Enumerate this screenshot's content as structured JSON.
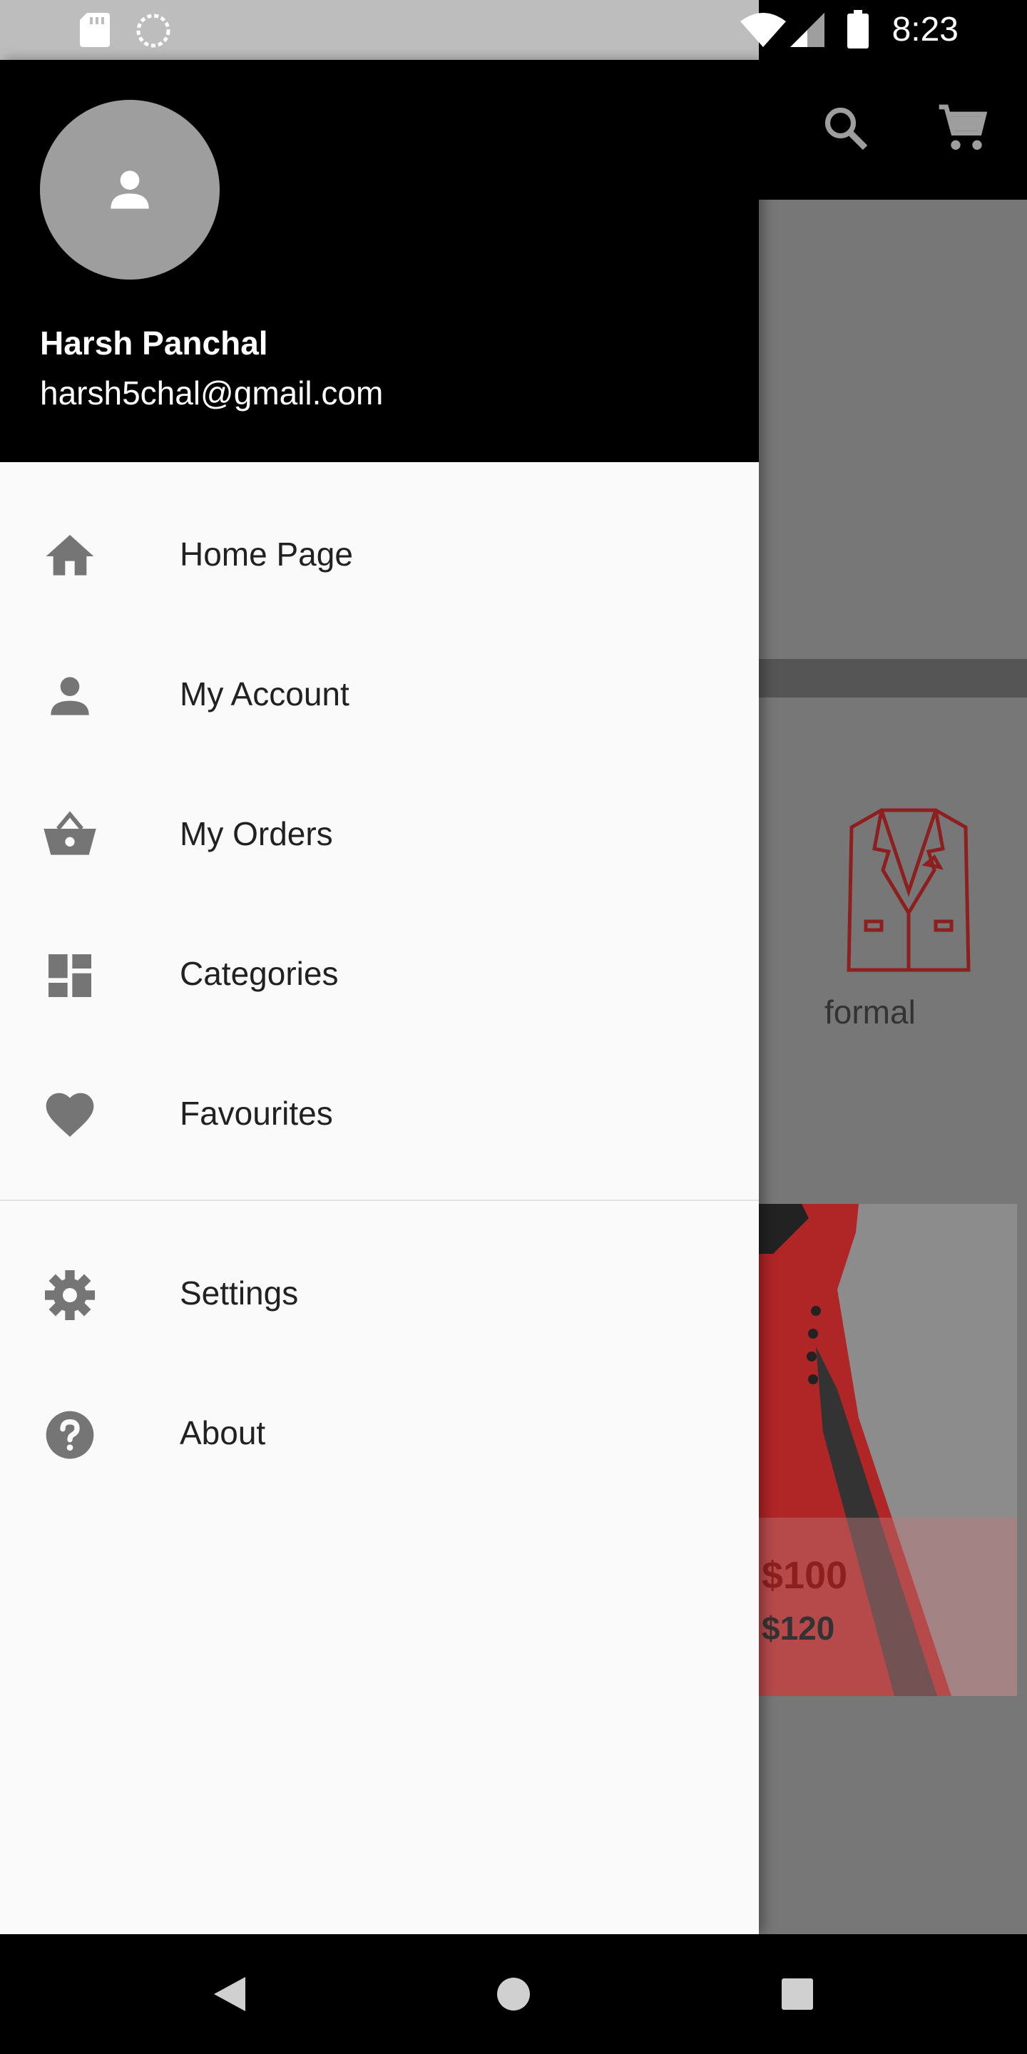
{
  "status_bar": {
    "time": "8:23",
    "icons": [
      "sd-card-icon",
      "sync-icon",
      "wifi-icon",
      "signal-icon",
      "battery-icon"
    ]
  },
  "app_bar": {
    "actions": [
      "search-icon",
      "cart-icon"
    ]
  },
  "drawer": {
    "user": {
      "name": "Harsh Panchal",
      "email": "harsh5chal@gmail.com",
      "avatar_icon": "person-icon"
    },
    "items": [
      {
        "label": "Home Page",
        "icon": "home-icon"
      },
      {
        "label": "My Account",
        "icon": "person-icon"
      },
      {
        "label": "My Orders",
        "icon": "basket-icon"
      },
      {
        "label": "Categories",
        "icon": "dashboard-icon"
      },
      {
        "label": "Favourites",
        "icon": "heart-icon"
      }
    ],
    "secondary_items": [
      {
        "label": "Settings",
        "icon": "gear-icon"
      },
      {
        "label": "About",
        "icon": "help-icon"
      }
    ]
  },
  "background": {
    "category_label": "formal",
    "product": {
      "price": "$100",
      "old_price": "$120"
    }
  },
  "nav_bar": {
    "buttons": [
      "back-icon",
      "home-circle-icon",
      "recents-icon"
    ]
  },
  "colors": {
    "drawer_header": "#000000",
    "drawer_bg": "#fafafa",
    "icon_gray": "#757575",
    "price_red": "#8e1f1f"
  }
}
